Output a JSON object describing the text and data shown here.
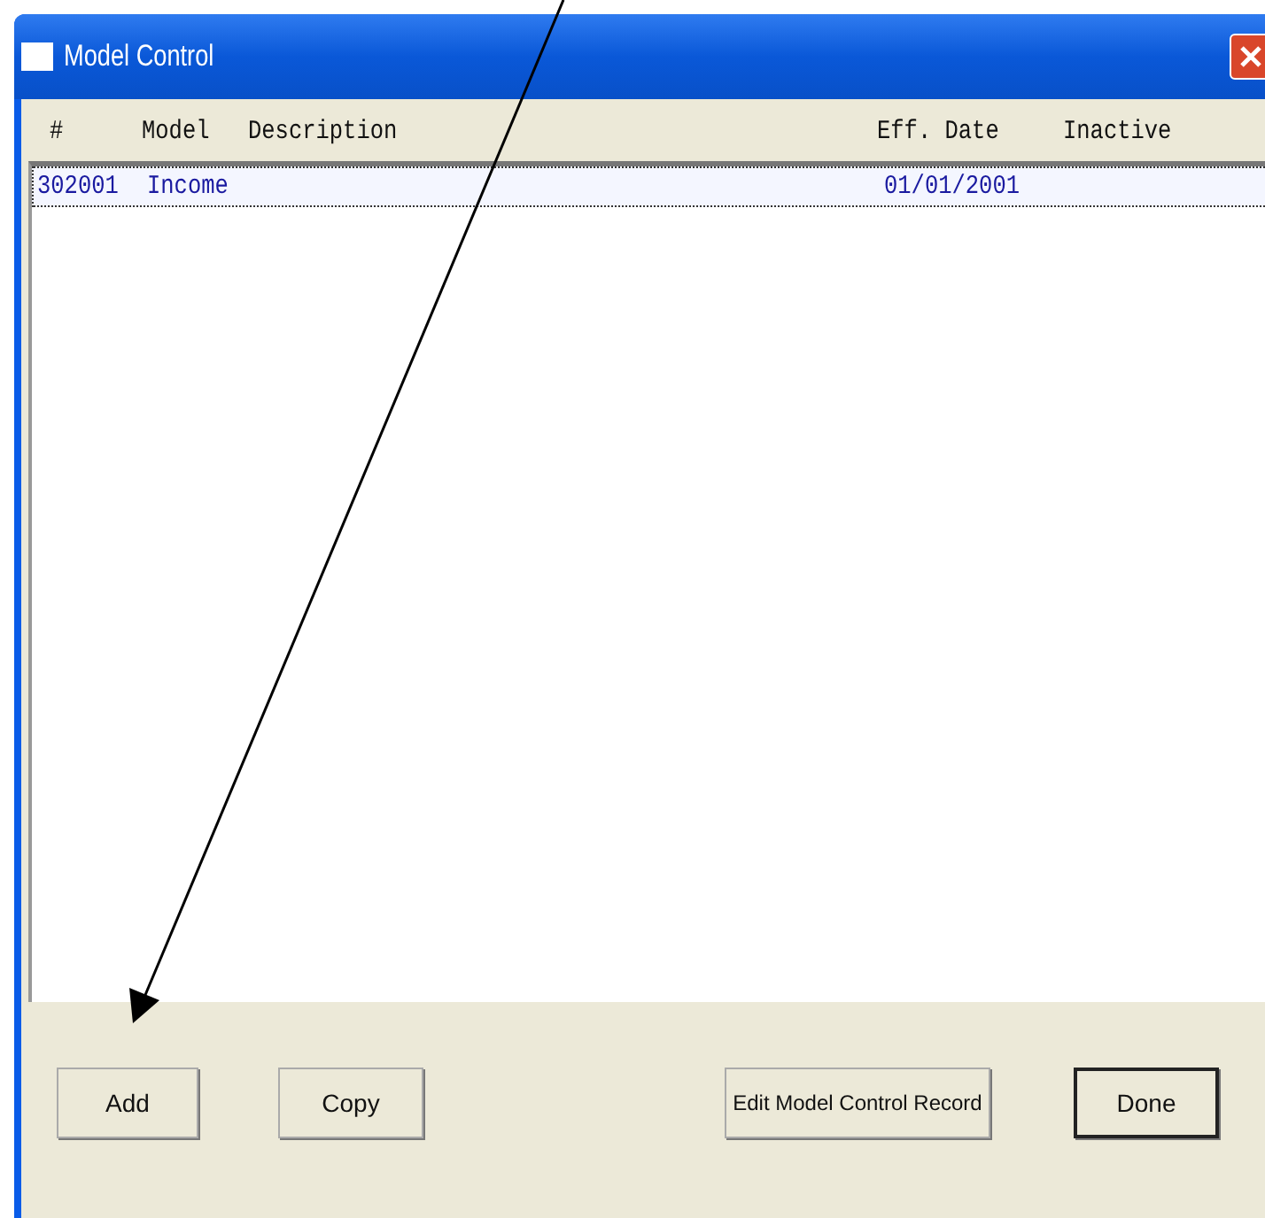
{
  "window": {
    "title": "Model Control"
  },
  "table": {
    "columns": [
      "#",
      "Model",
      "Description",
      "Eff. Date",
      "Inactive"
    ],
    "rows": [
      {
        "number": "302001",
        "model": "Income",
        "date": "01/01/2001",
        "selected": true
      }
    ]
  },
  "buttons": [
    {
      "label": "Add",
      "default": false
    },
    {
      "label": "Copy",
      "default": false
    },
    {
      "label": "Edit Model Control Record",
      "default": false
    },
    {
      "label": "Done",
      "default": true
    }
  ],
  "annotation": {
    "kind": "arrow"
  }
}
